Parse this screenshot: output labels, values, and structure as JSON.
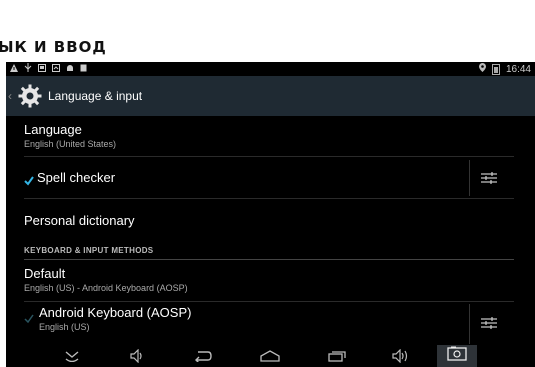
{
  "page": {
    "caption": "ЫК И ВВОД"
  },
  "status_bar": {
    "time": "16:44",
    "icons": [
      "warning-icon",
      "usb-icon",
      "sd-card-icon",
      "screenshot-icon",
      "android-debug-icon",
      "notification-icon",
      "location-icon",
      "battery-icon"
    ]
  },
  "action_bar": {
    "title": "Language & input",
    "icon": "gear-icon"
  },
  "settings": {
    "language": {
      "title": "Language",
      "subtitle": "English (United States)"
    },
    "spell_checker": {
      "title": "Spell checker",
      "checked": true
    },
    "personal_dictionary": {
      "title": "Personal dictionary"
    },
    "section_keyboard": "KEYBOARD & INPUT METHODS",
    "default": {
      "title": "Default",
      "subtitle": "English (US) - Android Keyboard (AOSP)"
    },
    "android_keyboard": {
      "title": "Android Keyboard (AOSP)",
      "subtitle": "English (US)",
      "checked": true
    }
  },
  "nav_bar": {
    "buttons": [
      "hide-keyboard-icon",
      "volume-down-icon",
      "back-icon",
      "home-icon",
      "recent-apps-icon",
      "volume-up-icon",
      "screenshot-icon"
    ]
  },
  "colors": {
    "action_bar": "#1f2a33",
    "accent": "#33b5e5",
    "background": "#000000"
  }
}
